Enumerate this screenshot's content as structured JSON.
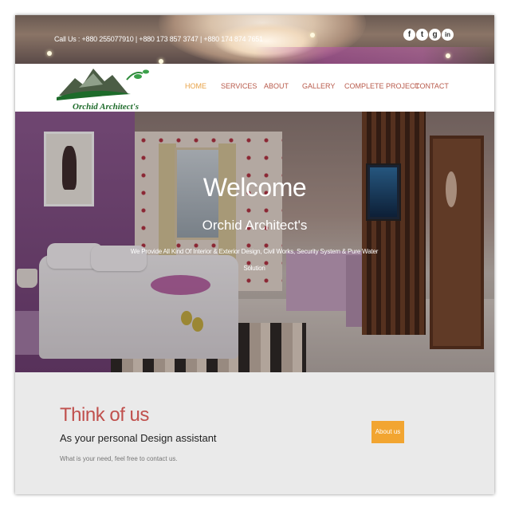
{
  "topbar": {
    "call_text": "Call Us : +880 255077910 | +880 173 857 3747 | +880 174 874 7651",
    "social": [
      {
        "icon": "facebook-icon",
        "glyph": "f"
      },
      {
        "icon": "twitter-icon",
        "glyph": "t"
      },
      {
        "icon": "google-plus-icon",
        "glyph": "g"
      },
      {
        "icon": "linkedin-icon",
        "glyph": "in"
      }
    ]
  },
  "brand": {
    "logo_text": "Orchid Architect's",
    "logo_colors": {
      "mountain": "#3f5a36",
      "leaf": "#1d6b2a"
    }
  },
  "nav": {
    "items": [
      "HOME",
      "SERVICES",
      "ABOUT",
      "GALLERY",
      "COMPLETE PROJECT",
      "CONTACT"
    ],
    "active": "HOME",
    "color": "#b85a4b",
    "active_color": "#e8a247"
  },
  "hero": {
    "title": "Welcome",
    "subtitle": "Orchid Architect's",
    "description": "We Provide All Kind Of Interior & Exterior Design, Civil Works, Security System & Pure Water Solution"
  },
  "think": {
    "title": "Think of us",
    "subtitle": "As your personal Design assistant",
    "note": "What is your need, feel free to contact us.",
    "button_label": "About us",
    "button_color": "#f2a531",
    "title_color": "#c0504d"
  }
}
